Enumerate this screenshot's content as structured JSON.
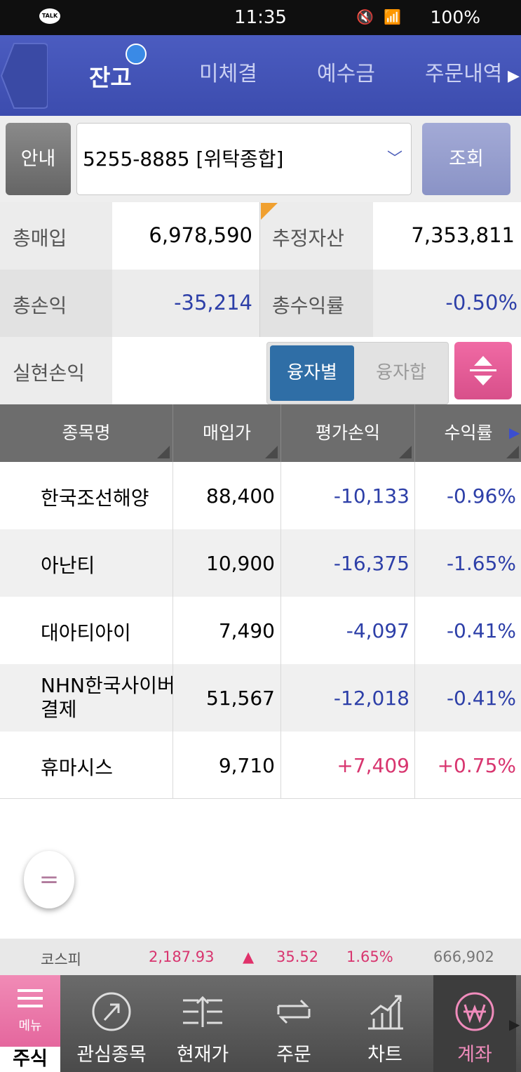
{
  "status_bar": {
    "time": "11:35",
    "app_badge": "TALK",
    "battery": "100%"
  },
  "tabs": [
    {
      "label": "잔고"
    },
    {
      "label": "미체결"
    },
    {
      "label": "예수금"
    },
    {
      "label": "주문내역"
    }
  ],
  "account": {
    "guide_label": "안내",
    "selected": "5255-8885 [위탁종합]",
    "search_label": "조회"
  },
  "summary": {
    "total_purchase_label": "총매입",
    "total_purchase": "6,978,590",
    "est_assets_label": "추정자산",
    "est_assets": "7,353,811",
    "total_pl_label": "총손익",
    "total_pl": "-35,214",
    "total_return_label": "총수익률",
    "total_return": "-0.50%",
    "realized_label": "실현손익",
    "realized": "",
    "toggle_by": "융자별",
    "toggle_sum": "융자합"
  },
  "table": {
    "headers": [
      "종목명",
      "매입가",
      "평가손익",
      "수익률"
    ],
    "rows": [
      {
        "name": "한국조선해양",
        "price": "88,400",
        "pl": "-10,133",
        "rate": "-0.96%"
      },
      {
        "name": "아난티",
        "price": "10,900",
        "pl": "-16,375",
        "rate": "-1.65%"
      },
      {
        "name": "대아티아이",
        "price": "7,490",
        "pl": "-4,097",
        "rate": "-0.41%"
      },
      {
        "name": "NHN한국사이버결제",
        "name_line1": "NHN한국사이버",
        "name_line2": "결제",
        "price": "51,567",
        "pl": "-12,018",
        "rate": "-0.41%"
      },
      {
        "name": "휴마시스",
        "price": "9,710",
        "pl": "+7,409",
        "rate": "+0.75%"
      }
    ]
  },
  "float_button": "=",
  "ticker": {
    "index_name": "코스피",
    "index_value": "2,187.93",
    "arrow": "▲",
    "change": "35.52",
    "change_pct": "1.65%",
    "volume": "666,902"
  },
  "bottom_nav": {
    "menu_sub": "메뉴",
    "menu_label": "주식",
    "items": [
      {
        "label": "관심종목",
        "icon": "star-circle-icon"
      },
      {
        "label": "현재가",
        "icon": "price-lines-icon"
      },
      {
        "label": "주문",
        "icon": "swap-arrows-icon"
      },
      {
        "label": "차트",
        "icon": "bar-chart-icon"
      },
      {
        "label": "계좌",
        "icon": "won-circle-icon"
      }
    ]
  },
  "colors": {
    "header_blue": "#4252b5",
    "negative": "#2d3fa8",
    "positive": "#d8356f",
    "accent_pink": "#e05a95"
  }
}
